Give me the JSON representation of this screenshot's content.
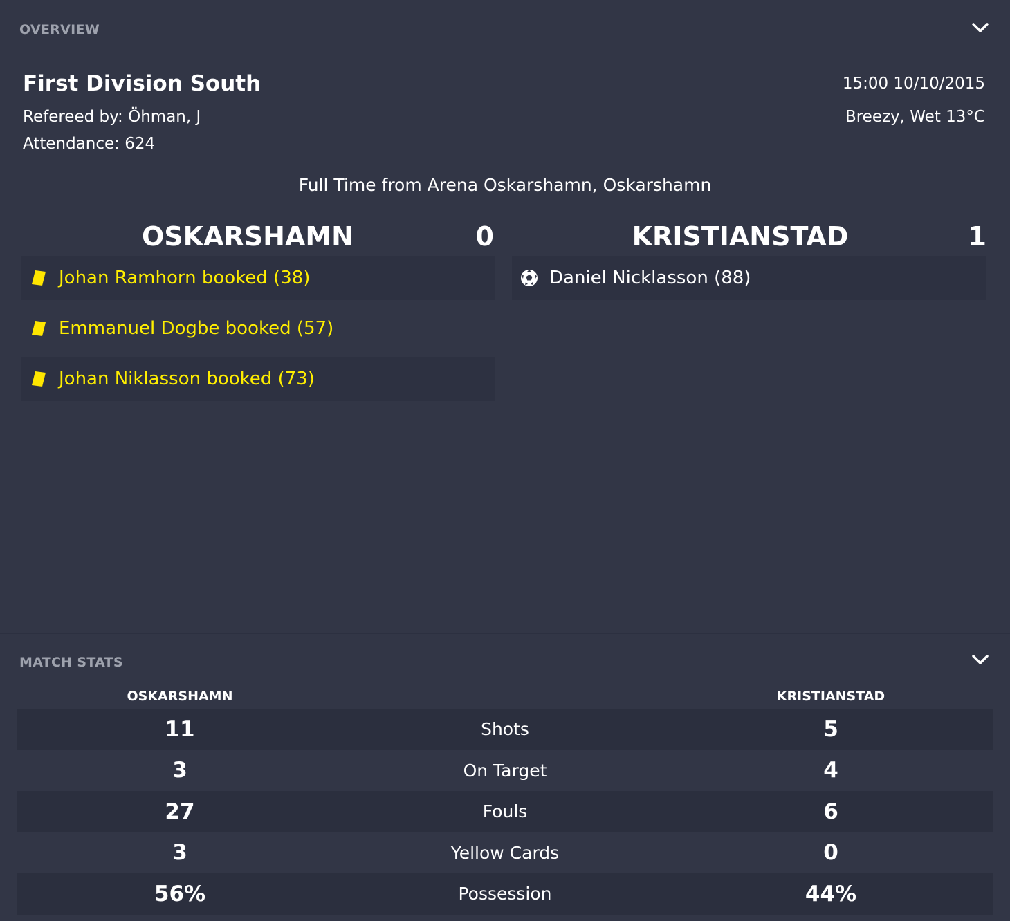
{
  "overview": {
    "section_title": "OVERVIEW",
    "competition": "First Division South",
    "referee": "Refereed by: Öhman, J",
    "attendance": "Attendance: 624",
    "datetime": "15:00 10/10/2015",
    "weather": "Breezy, Wet 13°C",
    "venue": "Full Time from Arena Oskarshamn, Oskarshamn"
  },
  "home": {
    "name": "OSKARSHAMN",
    "score": "0",
    "events": [
      {
        "type": "yellow-card",
        "text": "Johan Ramhorn booked (38)"
      },
      {
        "type": "yellow-card",
        "text": "Emmanuel Dogbe booked (57)"
      },
      {
        "type": "yellow-card",
        "text": "Johan Niklasson booked (73)"
      }
    ]
  },
  "away": {
    "name": "KRISTIANSTAD",
    "score": "1",
    "events": [
      {
        "type": "goal",
        "text": "Daniel Nicklasson (88)"
      }
    ]
  },
  "match_stats": {
    "section_title": "MATCH STATS",
    "home_header": "OSKARSHAMN",
    "away_header": "KRISTIANSTAD",
    "rows": [
      {
        "label": "Shots",
        "home": "11",
        "away": "5"
      },
      {
        "label": "On Target",
        "home": "3",
        "away": "4"
      },
      {
        "label": "Fouls",
        "home": "27",
        "away": "6"
      },
      {
        "label": "Yellow Cards",
        "home": "3",
        "away": "0"
      },
      {
        "label": "Possession",
        "home": "56%",
        "away": "44%"
      }
    ]
  },
  "colors": {
    "background": "#323646",
    "booking_text": "#ffee00",
    "yellow_card": "#ffe600",
    "muted_header": "#9ea2ad"
  },
  "icons": {
    "collapse": "chevron-down-icon",
    "booking": "yellow-card-icon",
    "goal": "football-icon"
  }
}
